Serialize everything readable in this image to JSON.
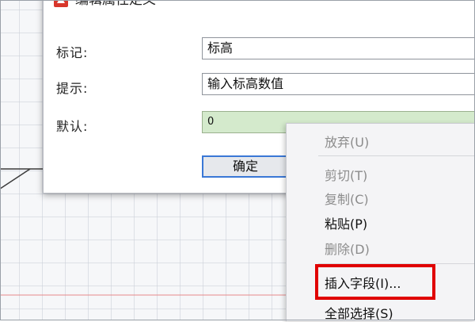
{
  "dialog": {
    "title": "编辑属性定义",
    "tag_label": "标记:",
    "tag_value": "标高",
    "prompt_label": "提示:",
    "prompt_value": "输入标高数值",
    "default_label": "默认:",
    "default_value": "0",
    "ok_label": "确定"
  },
  "context_menu": {
    "items": [
      {
        "label": "放弃(U)",
        "enabled": false
      },
      {
        "label": "剪切(T)",
        "enabled": false
      },
      {
        "label": "复制(C)",
        "enabled": false
      },
      {
        "label": "粘贴(P)",
        "enabled": true
      },
      {
        "label": "删除(D)",
        "enabled": false
      },
      {
        "label": "插入字段(I)...",
        "enabled": true
      },
      {
        "label": "全部选择(S)",
        "enabled": true
      }
    ]
  },
  "colors": {
    "highlight": "#e00000",
    "default_field_bg": "#d4eacc",
    "accent_border": "#3a78d6"
  }
}
